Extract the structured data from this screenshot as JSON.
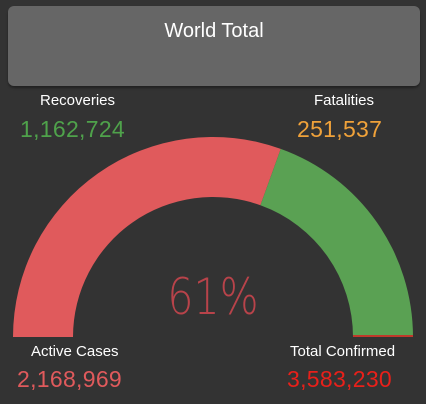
{
  "header": {
    "title": "World Total"
  },
  "recoveries": {
    "label": "Recoveries",
    "value": "1,162,724"
  },
  "fatalities": {
    "label": "Fatalities",
    "value": "251,537"
  },
  "active": {
    "label": "Active Cases",
    "value": "2,168,969"
  },
  "confirmed": {
    "label": "Total Confirmed",
    "value": "3,583,230"
  },
  "gauge": {
    "percent_label": "61%",
    "active_fraction": 0.61,
    "recovered_fraction": 0.32,
    "fatal_fraction": 0.07
  },
  "colors": {
    "background": "#333333",
    "header": "#666666",
    "active": "#e05a5c",
    "recovered": "#5aa153",
    "fatal": "#c0392b",
    "recovered_text": "#4fa24b",
    "fatal_text": "#f0a23a",
    "active_text": "#e05a5c",
    "confirmed_text": "#e8201a",
    "percent_text": "#b8434a"
  }
}
